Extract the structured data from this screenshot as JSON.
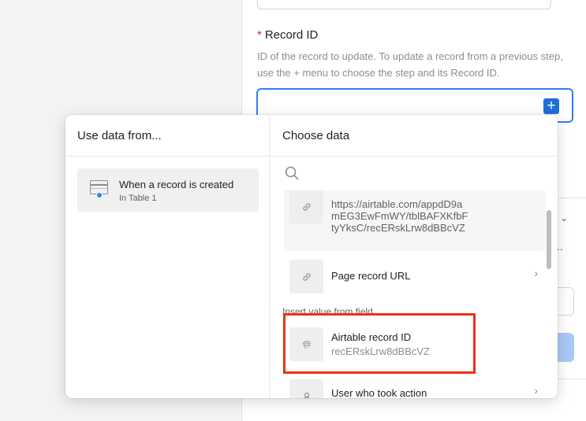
{
  "config_panel": {
    "field_required_mark": "*",
    "field_label": "Record ID",
    "field_description": "ID of the record to update. To update a record from a previous step, use the + menu to choose the step and its Record ID.",
    "record_id_value": "",
    "plus_symbol": "+",
    "partial_chevron": "⌄",
    "partial_text": "..",
    "accent_color": "#2d7ff9"
  },
  "popover": {
    "left_header": "Use data from...",
    "right_header": "Choose data",
    "sources": [
      {
        "title": "When a record is created",
        "subtitle": "In Table 1",
        "icon": "table-icon"
      }
    ],
    "search": {
      "placeholder": "",
      "icon": "search-icon"
    },
    "items": [
      {
        "icon": "link-icon",
        "value": "https://airtable.com/appdD9amEG3EwFmWY/tblBAFXKfbFtyYksC/recERskLrw8dBBcVZ"
      },
      {
        "icon": "link-icon",
        "title": "Page record URL",
        "chevron": "›"
      },
      {
        "section_label": "Insert value from field"
      },
      {
        "icon": "fingerprint-icon",
        "title": "Airtable record ID",
        "value": "recERskLrw8dBBcVZ"
      },
      {
        "icon": "user-icon",
        "title": "User who took action",
        "chevron": "›"
      }
    ],
    "highlight_color": "#e8330e"
  }
}
